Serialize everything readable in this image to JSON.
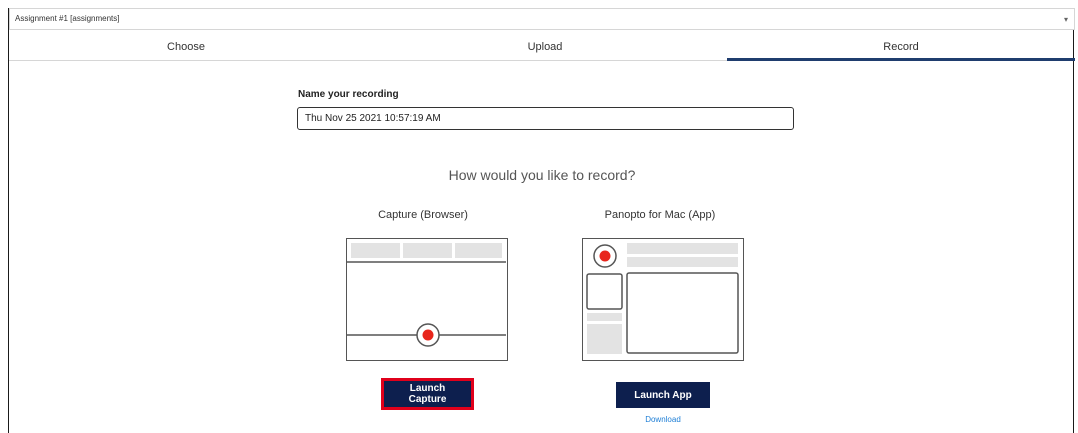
{
  "assignment_select": {
    "value": "Assignment #1 [assignments]"
  },
  "tabs": [
    {
      "label": "Choose"
    },
    {
      "label": "Upload"
    },
    {
      "label": "Record",
      "active": true
    }
  ],
  "recording": {
    "name_label": "Name your recording",
    "name_value": "Thu Nov 25 2021 10:57:19 AM"
  },
  "prompt": "How would you like to record?",
  "options": [
    {
      "title": "Capture (Browser)",
      "button": "Launch Capture",
      "icon": "browser-window-icon"
    },
    {
      "title": "Panopto for Mac (App)",
      "button": "Launch App",
      "link": "Download",
      "icon": "app-window-icon"
    }
  ],
  "colors": {
    "button_bg": "#0d1f4e",
    "active_tab": "#1f3d6e",
    "record_dot": "#e8261c",
    "highlight": "#e0001b",
    "link": "#1f7fd6"
  }
}
